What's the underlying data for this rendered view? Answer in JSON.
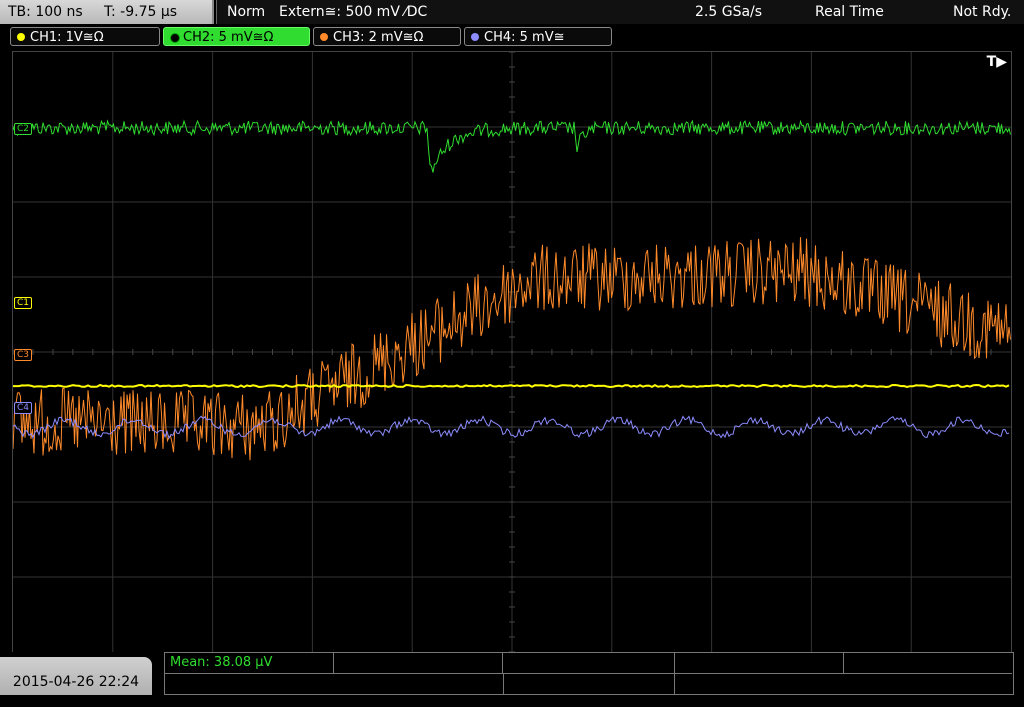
{
  "topbar": {
    "timebase": "TB: 100 ns",
    "trigger_time": "T: -9.75 µs",
    "mode": "Norm",
    "trigger_source": "Extern≅: 500 mV ⁄DC",
    "sample_rate": "2.5 GSa/s",
    "acq_mode": "Real Time",
    "status": "Not Rdy."
  },
  "channels": [
    {
      "label": "CH1: 1V≅Ω",
      "color": "#ffff00"
    },
    {
      "label": "CH2: 5 mV≅Ω",
      "color": "#2fdc2f"
    },
    {
      "label": "CH3: 2 mV≅Ω",
      "color": "#ff8a2a"
    },
    {
      "label": "CH4: 5 mV≅",
      "color": "#8c8cff"
    }
  ],
  "screen": {
    "trigger_marker": "T▶",
    "markers": [
      "C1",
      "C3",
      "C4",
      "C2"
    ]
  },
  "bottom": {
    "datetime": "2015-04-26 22:24",
    "measurement": "Mean: 38.08 µV"
  }
}
